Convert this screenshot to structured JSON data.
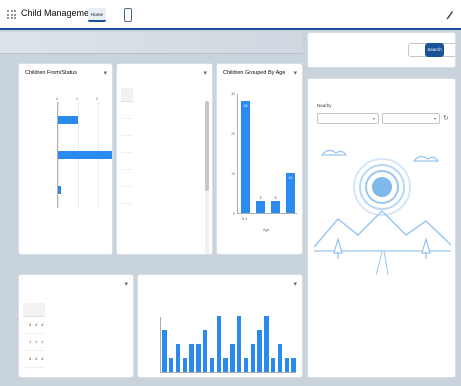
{
  "app": {
    "name": "Child Management",
    "nav": [
      "Home",
      "",
      "",
      "",
      "",
      "",
      ""
    ]
  },
  "banner": {
    "text": ""
  },
  "enrolment_card": {
    "title": "Children From/Status",
    "subtitle": "",
    "axis_title": "",
    "ticks": [
      "0",
      "1",
      "2",
      "3"
    ],
    "link": "",
    "chart_data": {
      "type": "bar",
      "orientation": "horizontal",
      "categories": [
        "",
        "",
        ""
      ],
      "values": [
        1,
        2.7,
        0.15
      ],
      "xlim": [
        0,
        3
      ]
    }
  },
  "centres_card": {
    "title": "",
    "columns": [
      "",
      "",
      ""
    ],
    "rows": [
      [
        "",
        "",
        ""
      ],
      [
        "",
        "",
        ""
      ],
      [
        "",
        "",
        ""
      ],
      [
        "",
        "",
        ""
      ],
      [
        "",
        "",
        ""
      ],
      [
        "",
        "",
        ""
      ]
    ],
    "link": ""
  },
  "age_card": {
    "title": "Children Grouped By Age",
    "ylabel": "",
    "xlabel": "Age",
    "link": "",
    "chart_data": {
      "type": "bar",
      "categories": [
        "0-1",
        "",
        "",
        ""
      ],
      "values": [
        28,
        3,
        3,
        10
      ],
      "ylim": [
        0,
        30
      ],
      "yticks": [
        "0",
        "10",
        "20",
        "30"
      ]
    }
  },
  "allocation_card": {
    "title": "",
    "columns": [
      "",
      "",
      "",
      ""
    ],
    "rows": [
      [
        "",
        "4",
        "4",
        "4"
      ],
      [
        "",
        "1",
        "1",
        "1"
      ],
      [
        "",
        "4",
        "4",
        "4"
      ]
    ]
  },
  "diagnosis_card": {
    "title": "",
    "ylabel": "",
    "chart_data": {
      "type": "bar",
      "values": [
        3,
        1,
        2,
        1,
        2,
        2,
        3,
        1,
        4,
        1,
        2,
        4,
        1,
        2,
        3,
        4,
        1,
        2,
        1,
        1
      ],
      "ylim": [
        0,
        4
      ]
    }
  },
  "search_card": {
    "placeholder": "",
    "button": "Search"
  },
  "map_card": {
    "label": "Nearby",
    "select_primary": "",
    "select_secondary": "",
    "empty_title": "",
    "empty_sub": ""
  },
  "footer": {
    "text": ""
  }
}
